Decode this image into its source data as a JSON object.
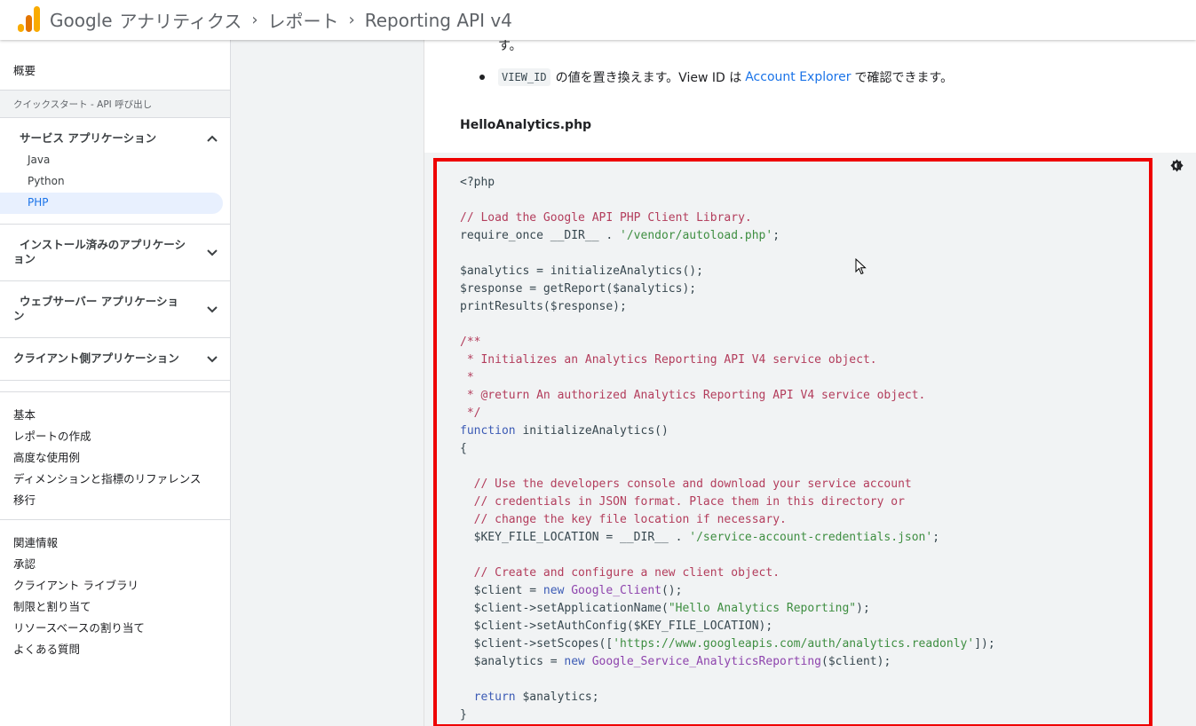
{
  "header": {
    "product_google": "Google",
    "product_name": "アナリティクス",
    "breadcrumbs": [
      "レポート",
      "Reporting API v4"
    ],
    "separator": "›"
  },
  "sidebar": {
    "overview": "概要",
    "section_title": "クイックスタート - API 呼び出し",
    "groups": [
      {
        "title": "サービス アプリケーション",
        "expanded": true,
        "items": [
          "Java",
          "Python",
          "PHP"
        ],
        "active": "PHP"
      },
      {
        "title_line1": "インストール済みのアプリケーシ",
        "title_line2": "ョン",
        "expanded": false
      },
      {
        "title_line1": "ウェブサーバー アプリケーショ",
        "title_line2": "ン",
        "expanded": false
      },
      {
        "title": "クライアント側アプリケーション",
        "expanded": false
      }
    ],
    "basics": [
      "基本",
      "レポートの作成",
      "高度な使用例",
      "ディメンションと指標のリファレンス",
      "移行"
    ],
    "related": [
      "関連情報",
      "承認",
      "クライアント ライブラリ",
      "制限と割り当て",
      "リソースベースの割り当て",
      "よくある質問"
    ]
  },
  "article": {
    "fragment": "す。",
    "bullet_code": "VIEW_ID",
    "bullet_text_before": "の値を置き換えます。View ID は",
    "bullet_link": "Account Explorer",
    "bullet_text_after": "で確認できます。",
    "filename": "HelloAnalytics.php"
  },
  "colors": {
    "highlight": "#ee0000",
    "link": "#1a73e8",
    "comment": "#b33d5c",
    "string": "#3e8e41",
    "keyword": "#3c5bb5"
  },
  "icons": [
    "analytics-logo",
    "chevron-up-icon",
    "chevron-down-icon",
    "theme-toggle-icon",
    "mouse-cursor"
  ]
}
